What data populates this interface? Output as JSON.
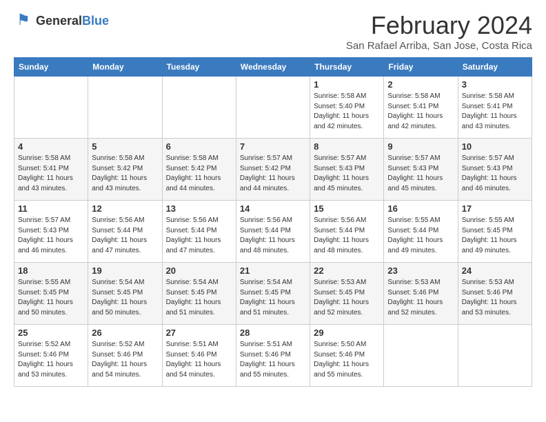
{
  "header": {
    "logo_general": "General",
    "logo_blue": "Blue",
    "title": "February 2024",
    "subtitle": "San Rafael Arriba, San Jose, Costa Rica"
  },
  "days_of_week": [
    "Sunday",
    "Monday",
    "Tuesday",
    "Wednesday",
    "Thursday",
    "Friday",
    "Saturday"
  ],
  "weeks": [
    [
      {
        "day": "",
        "info": ""
      },
      {
        "day": "",
        "info": ""
      },
      {
        "day": "",
        "info": ""
      },
      {
        "day": "",
        "info": ""
      },
      {
        "day": "1",
        "info": "Sunrise: 5:58 AM\nSunset: 5:40 PM\nDaylight: 11 hours\nand 42 minutes."
      },
      {
        "day": "2",
        "info": "Sunrise: 5:58 AM\nSunset: 5:41 PM\nDaylight: 11 hours\nand 42 minutes."
      },
      {
        "day": "3",
        "info": "Sunrise: 5:58 AM\nSunset: 5:41 PM\nDaylight: 11 hours\nand 43 minutes."
      }
    ],
    [
      {
        "day": "4",
        "info": "Sunrise: 5:58 AM\nSunset: 5:41 PM\nDaylight: 11 hours\nand 43 minutes."
      },
      {
        "day": "5",
        "info": "Sunrise: 5:58 AM\nSunset: 5:42 PM\nDaylight: 11 hours\nand 43 minutes."
      },
      {
        "day": "6",
        "info": "Sunrise: 5:58 AM\nSunset: 5:42 PM\nDaylight: 11 hours\nand 44 minutes."
      },
      {
        "day": "7",
        "info": "Sunrise: 5:57 AM\nSunset: 5:42 PM\nDaylight: 11 hours\nand 44 minutes."
      },
      {
        "day": "8",
        "info": "Sunrise: 5:57 AM\nSunset: 5:43 PM\nDaylight: 11 hours\nand 45 minutes."
      },
      {
        "day": "9",
        "info": "Sunrise: 5:57 AM\nSunset: 5:43 PM\nDaylight: 11 hours\nand 45 minutes."
      },
      {
        "day": "10",
        "info": "Sunrise: 5:57 AM\nSunset: 5:43 PM\nDaylight: 11 hours\nand 46 minutes."
      }
    ],
    [
      {
        "day": "11",
        "info": "Sunrise: 5:57 AM\nSunset: 5:43 PM\nDaylight: 11 hours\nand 46 minutes."
      },
      {
        "day": "12",
        "info": "Sunrise: 5:56 AM\nSunset: 5:44 PM\nDaylight: 11 hours\nand 47 minutes."
      },
      {
        "day": "13",
        "info": "Sunrise: 5:56 AM\nSunset: 5:44 PM\nDaylight: 11 hours\nand 47 minutes."
      },
      {
        "day": "14",
        "info": "Sunrise: 5:56 AM\nSunset: 5:44 PM\nDaylight: 11 hours\nand 48 minutes."
      },
      {
        "day": "15",
        "info": "Sunrise: 5:56 AM\nSunset: 5:44 PM\nDaylight: 11 hours\nand 48 minutes."
      },
      {
        "day": "16",
        "info": "Sunrise: 5:55 AM\nSunset: 5:44 PM\nDaylight: 11 hours\nand 49 minutes."
      },
      {
        "day": "17",
        "info": "Sunrise: 5:55 AM\nSunset: 5:45 PM\nDaylight: 11 hours\nand 49 minutes."
      }
    ],
    [
      {
        "day": "18",
        "info": "Sunrise: 5:55 AM\nSunset: 5:45 PM\nDaylight: 11 hours\nand 50 minutes."
      },
      {
        "day": "19",
        "info": "Sunrise: 5:54 AM\nSunset: 5:45 PM\nDaylight: 11 hours\nand 50 minutes."
      },
      {
        "day": "20",
        "info": "Sunrise: 5:54 AM\nSunset: 5:45 PM\nDaylight: 11 hours\nand 51 minutes."
      },
      {
        "day": "21",
        "info": "Sunrise: 5:54 AM\nSunset: 5:45 PM\nDaylight: 11 hours\nand 51 minutes."
      },
      {
        "day": "22",
        "info": "Sunrise: 5:53 AM\nSunset: 5:45 PM\nDaylight: 11 hours\nand 52 minutes."
      },
      {
        "day": "23",
        "info": "Sunrise: 5:53 AM\nSunset: 5:46 PM\nDaylight: 11 hours\nand 52 minutes."
      },
      {
        "day": "24",
        "info": "Sunrise: 5:53 AM\nSunset: 5:46 PM\nDaylight: 11 hours\nand 53 minutes."
      }
    ],
    [
      {
        "day": "25",
        "info": "Sunrise: 5:52 AM\nSunset: 5:46 PM\nDaylight: 11 hours\nand 53 minutes."
      },
      {
        "day": "26",
        "info": "Sunrise: 5:52 AM\nSunset: 5:46 PM\nDaylight: 11 hours\nand 54 minutes."
      },
      {
        "day": "27",
        "info": "Sunrise: 5:51 AM\nSunset: 5:46 PM\nDaylight: 11 hours\nand 54 minutes."
      },
      {
        "day": "28",
        "info": "Sunrise: 5:51 AM\nSunset: 5:46 PM\nDaylight: 11 hours\nand 55 minutes."
      },
      {
        "day": "29",
        "info": "Sunrise: 5:50 AM\nSunset: 5:46 PM\nDaylight: 11 hours\nand 55 minutes."
      },
      {
        "day": "",
        "info": ""
      },
      {
        "day": "",
        "info": ""
      }
    ]
  ]
}
